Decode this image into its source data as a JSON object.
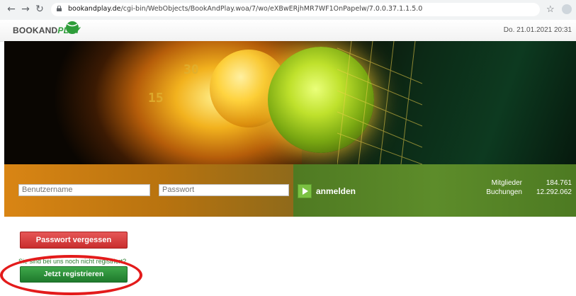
{
  "browser": {
    "url_domain": "bookandplay.de",
    "url_path": "/cgi-bin/WebObjects/BookAndPlay.woa/7/wo/eXBwERjhMR7WF1OnPapelw/7.0.0.37.1.1.5.0",
    "back_icon": "arrow-left-icon",
    "forward_icon": "arrow-right-icon",
    "reload_icon": "reload-icon",
    "star_icon": "star-icon"
  },
  "header": {
    "logo_book": "BOOKAND",
    "logo_play": "PLAY",
    "datetime": "Do. 21.01.2021 20:31"
  },
  "hero": {
    "score_top": "30",
    "score_bottom": "15"
  },
  "login": {
    "username_placeholder": "Benutzername",
    "password_placeholder": "Passwort",
    "login_label": "anmelden"
  },
  "stats": {
    "members_label": "Mitglieder",
    "members_value": "184.761",
    "bookings_label": "Buchungen",
    "bookings_value": "12.292.062"
  },
  "actions": {
    "forgot_password": "Passwort vergessen",
    "not_registered": "Sie sind bei uns noch nicht registriert?",
    "register": "Jetzt registrieren"
  },
  "colors": {
    "accent_green": "#2e9d3a",
    "forgot_red": "#d93c3c",
    "highlight_red": "#e31b1b"
  }
}
